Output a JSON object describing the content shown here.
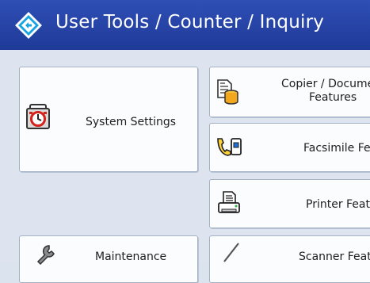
{
  "header": {
    "title": "User Tools / Counter / Inquiry",
    "icon": "diamond-arrow-icon"
  },
  "menu": {
    "system_settings": {
      "label": "System Settings",
      "icon": "alarm-clock-icon"
    },
    "maintenance": {
      "label": "Maintenance",
      "icon": "wrench-icon"
    },
    "copier": {
      "label_line1": "Copier / Document",
      "label_line2": "Features",
      "icon": "document-server-icon"
    },
    "facsimile": {
      "label": "Facsimile Feat",
      "icon": "fax-icon"
    },
    "printer": {
      "label": "Printer Featur",
      "icon": "printer-icon"
    },
    "scanner": {
      "label": "Scanner Featu",
      "icon": "scanner-icon"
    }
  }
}
